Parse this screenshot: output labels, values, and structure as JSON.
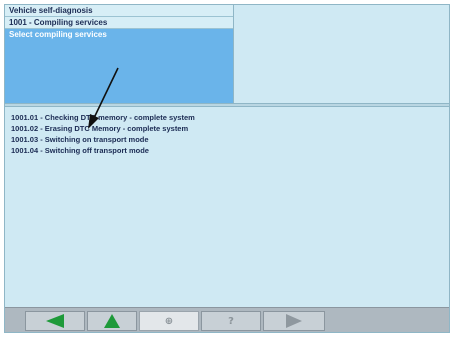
{
  "header": {
    "title": "Vehicle self-diagnosis",
    "subtitle": "1001 - Compiling services",
    "selected": "Select compiling services"
  },
  "services": [
    "1001.01 - Checking DTC memory - complete system",
    "1001.02 - Erasing DTC Memory - complete system",
    "1001.03 - Switching on transport mode",
    "1001.04 - Switching off transport mode"
  ],
  "toolbar": {
    "back_icon": "arrow-left-icon",
    "up_icon": "arrow-up-icon",
    "print_label": "⊕",
    "help_label": "?",
    "forward_icon": "arrow-right-icon"
  },
  "colors": {
    "background": "#cfe9f3",
    "selection": "#6ab4ea",
    "nav_green": "#1e9a3a",
    "toolbar": "#aeb8c0"
  }
}
